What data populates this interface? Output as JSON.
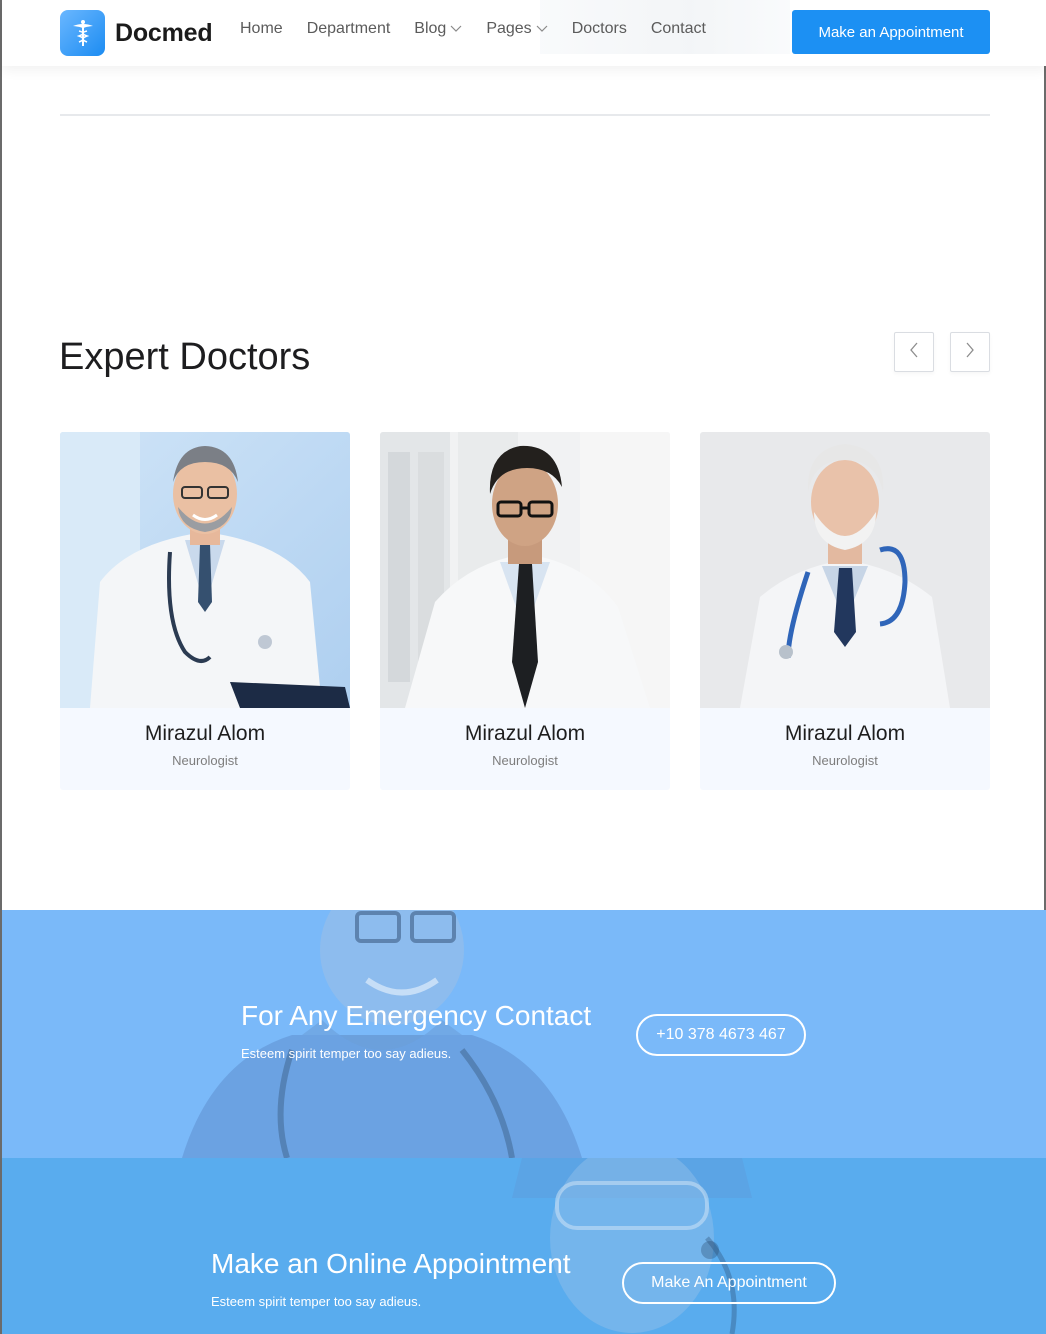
{
  "header": {
    "brand": "Docmed",
    "nav": [
      {
        "label": "Home",
        "has_dropdown": false
      },
      {
        "label": "Department",
        "has_dropdown": false
      },
      {
        "label": "Blog",
        "has_dropdown": true
      },
      {
        "label": "Pages",
        "has_dropdown": true
      },
      {
        "label": "Doctors",
        "has_dropdown": false
      },
      {
        "label": "Contact",
        "has_dropdown": false
      }
    ],
    "cta_label": "Make an Appointment"
  },
  "doctors_section": {
    "title": "Expert Doctors",
    "prev_icon": "chevron-left-icon",
    "next_icon": "chevron-right-icon",
    "cards": [
      {
        "name": "Mirazul Alom",
        "role": "Neurologist"
      },
      {
        "name": "Mirazul Alom",
        "role": "Neurologist"
      },
      {
        "name": "Mirazul Alom",
        "role": "Neurologist"
      }
    ]
  },
  "emergency": {
    "title": "For Any Emergency Contact",
    "subtitle": "Esteem spirit temper too say adieus.",
    "phone": "+10 378 4673 467"
  },
  "online": {
    "title": "Make an Online Appointment",
    "subtitle": "Esteem spirit temper too say adieus.",
    "button_label": "Make An Appointment"
  },
  "colors": {
    "accent": "#1c90f3",
    "emergency_bg": "#7ab9f9",
    "online_bg": "#59acee",
    "card_bg": "#f5f9ff"
  }
}
